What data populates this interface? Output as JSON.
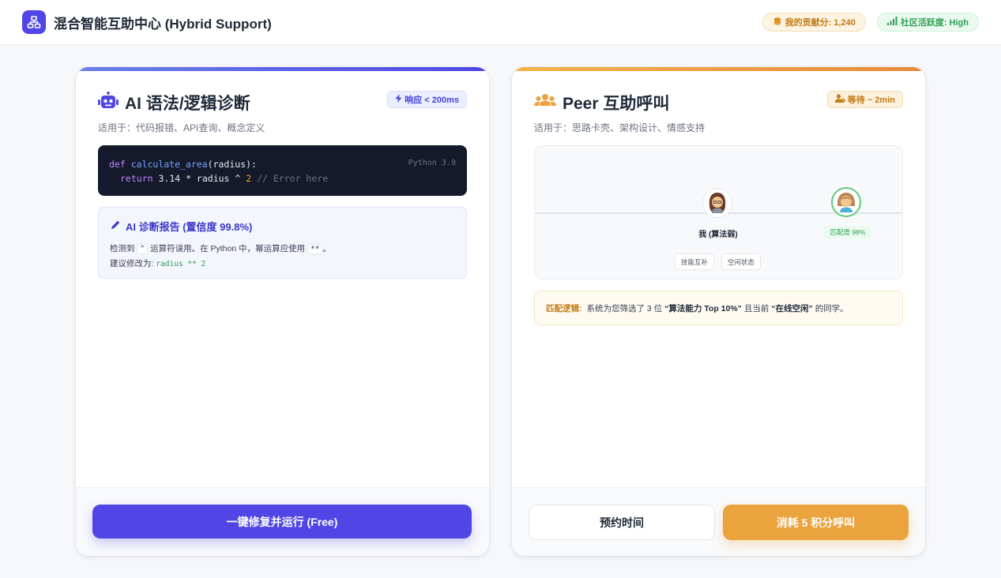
{
  "app": {
    "title": "混合智能互助中心 (Hybrid Support)",
    "contribution": "我的贡献分: 1,240",
    "activity": "社区活跃度: High"
  },
  "ai_card": {
    "title": "AI 语法/逻辑诊断",
    "badge": "响应 < 200ms",
    "subtitle": "适用于：代码报错、API查询、概念定义",
    "code": {
      "language": "Python 3.9",
      "line1_kw": "def",
      "line1_fn": "calculate_area",
      "line1_rest": "(radius):",
      "line2_kw": "return",
      "line2_expr": " 3.14 * radius ^ ",
      "line2_num": "2",
      "line2_comment": " // Error here"
    },
    "report": {
      "title": "AI 诊断报告 (置信度 99.8%)",
      "text_a": "检测到",
      "op_caret": "^",
      "text_b": "运算符误用。在 Python 中，幂运算应使用",
      "op_pow": "**",
      "text_c": "。",
      "suggest_label": "建议修改为:",
      "suggest_code": "radius ** 2"
    },
    "button": "一键修复并运行 (Free)"
  },
  "peer_card": {
    "title": "Peer 互助呼叫",
    "badge": "等待 ~ 2min",
    "subtitle": "适用于：思路卡壳、架构设计、情感支持",
    "me_label": "我 (算法弱)",
    "match_label": "匹配度 98%",
    "tags": [
      "技能互补",
      "空闲状态"
    ],
    "logic": {
      "label": "匹配逻辑:",
      "text_a": "系统为您筛选了 3 位",
      "bold_a": "“算法能力 Top 10%”",
      "text_b": "且当前",
      "bold_b": "“在线空闲”",
      "text_c": "的同学。"
    },
    "btn_schedule": "预约时间",
    "btn_call": "消耗 5 积分呼叫"
  },
  "colors": {
    "primary": "#4f46e5",
    "orange": "#eba33e",
    "green": "#2e9e54"
  },
  "icons": [
    "sitemap-icon",
    "coins-icon",
    "signal-icon",
    "robot-icon",
    "bolt-icon",
    "pen-icon",
    "users-icon",
    "user-clock-icon",
    "avatar-me-icon",
    "avatar-match-icon"
  ]
}
